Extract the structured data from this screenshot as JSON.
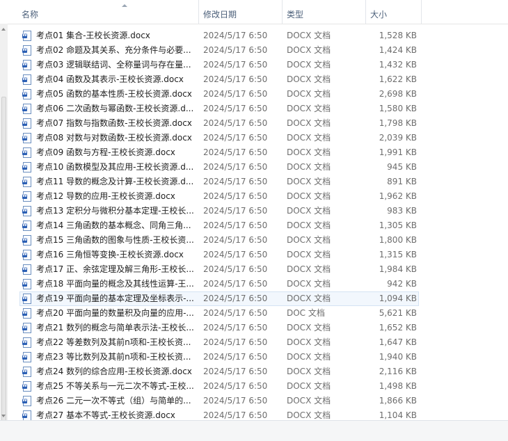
{
  "columns": {
    "name": "名称",
    "date": "修改日期",
    "type": "类型",
    "size": "大小"
  },
  "files": [
    {
      "name": "考点01 集合-王校长资源.docx",
      "date": "2024/5/17 6:50",
      "type": "DOCX 文档",
      "size": "1,528 KB"
    },
    {
      "name": "考点02 命题及其关系、充分条件与必要...",
      "date": "2024/5/17 6:50",
      "type": "DOCX 文档",
      "size": "1,424 KB"
    },
    {
      "name": "考点03 逻辑联结词、全称量词与存在量...",
      "date": "2024/5/17 6:50",
      "type": "DOCX 文档",
      "size": "1,432 KB"
    },
    {
      "name": "考点04 函数及其表示-王校长资源.docx",
      "date": "2024/5/17 6:50",
      "type": "DOCX 文档",
      "size": "1,622 KB"
    },
    {
      "name": "考点05 函数的基本性质-王校长资源.docx",
      "date": "2024/5/17 6:50",
      "type": "DOCX 文档",
      "size": "2,698 KB"
    },
    {
      "name": "考点06 二次函数与幂函数-王校长资源.d...",
      "date": "2024/5/17 6:50",
      "type": "DOCX 文档",
      "size": "1,580 KB"
    },
    {
      "name": "考点07 指数与指数函数-王校长资源.docx",
      "date": "2024/5/17 6:50",
      "type": "DOCX 文档",
      "size": "1,798 KB"
    },
    {
      "name": "考点08 对数与对数函数-王校长资源.docx",
      "date": "2024/5/17 6:50",
      "type": "DOCX 文档",
      "size": "2,039 KB"
    },
    {
      "name": "考点09 函数与方程-王校长资源.docx",
      "date": "2024/5/17 6:50",
      "type": "DOCX 文档",
      "size": "1,991 KB"
    },
    {
      "name": "考点10 函数模型及其应用-王校长资源.d...",
      "date": "2024/5/17 6:50",
      "type": "DOCX 文档",
      "size": "945 KB"
    },
    {
      "name": "考点11 导数的概念及计算-王校长资源.d...",
      "date": "2024/5/17 6:50",
      "type": "DOCX 文档",
      "size": "891 KB"
    },
    {
      "name": "考点12 导数的应用-王校长资源.docx",
      "date": "2024/5/17 6:50",
      "type": "DOCX 文档",
      "size": "1,962 KB"
    },
    {
      "name": "考点13 定积分与微积分基本定理-王校长...",
      "date": "2024/5/17 6:50",
      "type": "DOCX 文档",
      "size": "983 KB"
    },
    {
      "name": "考点14 三角函数的基本概念、同角三角...",
      "date": "2024/5/17 6:50",
      "type": "DOCX 文档",
      "size": "1,305 KB"
    },
    {
      "name": "考点15 三角函数的图象与性质-王校长资...",
      "date": "2024/5/17 6:50",
      "type": "DOCX 文档",
      "size": "1,800 KB"
    },
    {
      "name": "考点16 三角恒等变换-王校长资源.docx",
      "date": "2024/5/17 6:50",
      "type": "DOCX 文档",
      "size": "1,315 KB"
    },
    {
      "name": "考点17 正、余弦定理及解三角形-王校长...",
      "date": "2024/5/17 6:50",
      "type": "DOCX 文档",
      "size": "1,984 KB"
    },
    {
      "name": "考点18 平面向量的概念及其线性运算-王...",
      "date": "2024/5/17 6:50",
      "type": "DOCX 文档",
      "size": "942 KB"
    },
    {
      "name": "考点19 平面向量的基本定理及坐标表示-...",
      "date": "2024/5/17 6:50",
      "type": "DOCX 文档",
      "size": "1,094 KB"
    },
    {
      "name": "考点20 平面向量的数量积及向量的应用-...",
      "date": "2024/5/17 6:50",
      "type": "DOC 文档",
      "size": "5,621 KB"
    },
    {
      "name": "考点21 数列的概念与简单表示法-王校长...",
      "date": "2024/5/17 6:50",
      "type": "DOCX 文档",
      "size": "1,652 KB"
    },
    {
      "name": "考点22 等差数列及其前n项和-王校长资...",
      "date": "2024/5/17 6:50",
      "type": "DOCX 文档",
      "size": "1,647 KB"
    },
    {
      "name": "考点23 等比数列及其前n项和-王校长资...",
      "date": "2024/5/17 6:50",
      "type": "DOCX 文档",
      "size": "1,940 KB"
    },
    {
      "name": "考点24 数列的综合应用-王校长资源.docx",
      "date": "2024/5/17 6:50",
      "type": "DOCX 文档",
      "size": "2,116 KB"
    },
    {
      "name": "考点25 不等关系与一元二次不等式-王校...",
      "date": "2024/5/17 6:50",
      "type": "DOCX 文档",
      "size": "1,498 KB"
    },
    {
      "name": "考点26 二元一次不等式（组）与简单的...",
      "date": "2024/5/17 6:50",
      "type": "DOCX 文档",
      "size": "1,866 KB"
    },
    {
      "name": "考点27 基本不等式-王校长资源.docx",
      "date": "2024/5/17 6:50",
      "type": "DOCX 文档",
      "size": "1,104 KB"
    }
  ],
  "hover_index": 18,
  "icon": "word-document-icon"
}
